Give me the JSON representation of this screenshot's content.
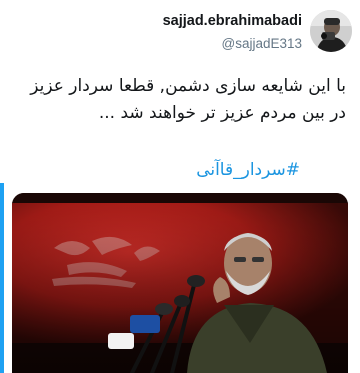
{
  "user": {
    "display_name": "sajjad.ebrahimabadi",
    "handle": "@sajjadE313",
    "avatar_icon": "avatar-photo"
  },
  "tweet": {
    "text_lines": [
      "با این شایعه سازی دشمن, قطعا سردار عزیز",
      "در بین مردم عزیز تر خواهند شد ..."
    ],
    "hashtag": "#سردار_قاآنی"
  },
  "colors": {
    "link": "#1b95e0",
    "accent": "#1da1f2",
    "text": "#14171a",
    "muted": "#657786"
  },
  "media": {
    "icon": "photo-of-speaker-at-microphones"
  }
}
